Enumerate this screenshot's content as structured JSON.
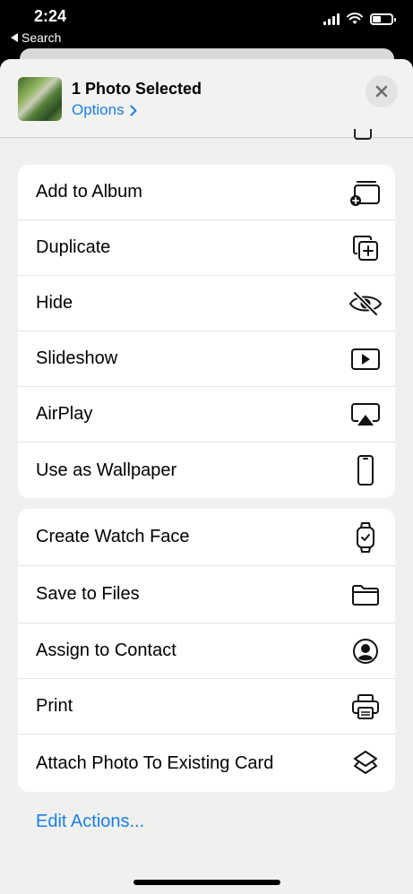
{
  "status_bar": {
    "time": "2:24",
    "back_label": "Search"
  },
  "header": {
    "title": "1 Photo Selected",
    "options_label": "Options"
  },
  "groups": [
    {
      "items": [
        {
          "label": "Add to Album",
          "icon": "add-to-album-icon"
        },
        {
          "label": "Duplicate",
          "icon": "duplicate-icon"
        },
        {
          "label": "Hide",
          "icon": "hide-eye-slash-icon"
        },
        {
          "label": "Slideshow",
          "icon": "slideshow-play-icon"
        },
        {
          "label": "AirPlay",
          "icon": "airplay-icon"
        },
        {
          "label": "Use as Wallpaper",
          "icon": "phone-wallpaper-icon"
        }
      ]
    },
    {
      "items": [
        {
          "label": "Create Watch Face",
          "icon": "watch-icon"
        },
        {
          "label": "Save to Files",
          "icon": "folder-icon"
        },
        {
          "label": "Assign to Contact",
          "icon": "contact-icon"
        },
        {
          "label": "Print",
          "icon": "printer-icon"
        },
        {
          "label": "Attach Photo To Existing Card",
          "icon": "layers-icon"
        }
      ]
    }
  ],
  "footer": {
    "edit_actions_label": "Edit Actions..."
  },
  "colors": {
    "accent": "#1a7fe6",
    "sheet_background": "#f0f1ee"
  }
}
